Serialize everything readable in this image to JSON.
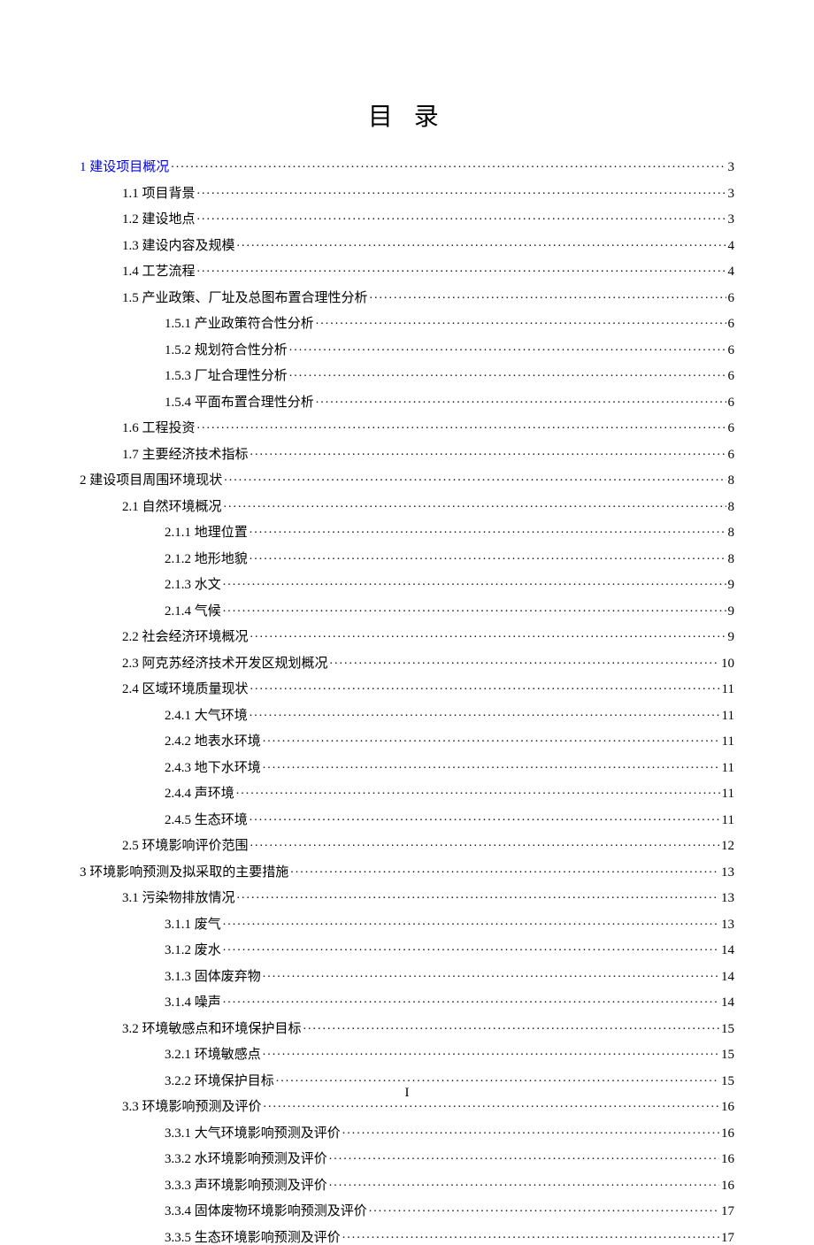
{
  "title": "目 录",
  "page_number": "I",
  "toc": [
    {
      "level": 1,
      "label": "1 建设项目概况",
      "page": "3",
      "link": true
    },
    {
      "level": 2,
      "label": "1.1 项目背景",
      "page": "3",
      "link": false
    },
    {
      "level": 2,
      "label": "1.2 建设地点",
      "page": "3",
      "link": false
    },
    {
      "level": 2,
      "label": "1.3 建设内容及规模",
      "page": "4",
      "link": false
    },
    {
      "level": 2,
      "label": "1.4 工艺流程",
      "page": "4",
      "link": false
    },
    {
      "level": 2,
      "label": "1.5 产业政策、厂址及总图布置合理性分析",
      "page": "6",
      "link": false
    },
    {
      "level": 3,
      "label": "1.5.1 产业政策符合性分析",
      "page": "6",
      "link": false
    },
    {
      "level": 3,
      "label": "1.5.2 规划符合性分析",
      "page": "6",
      "link": false
    },
    {
      "level": 3,
      "label": "1.5.3 厂址合理性分析",
      "page": "6",
      "link": false
    },
    {
      "level": 3,
      "label": "1.5.4 平面布置合理性分析",
      "page": "6",
      "link": false
    },
    {
      "level": 2,
      "label": "1.6 工程投资",
      "page": "6",
      "link": false
    },
    {
      "level": 2,
      "label": "1.7 主要经济技术指标",
      "page": "6",
      "link": false
    },
    {
      "level": 1,
      "label": "2 建设项目周围环境现状",
      "page": "8",
      "link": false
    },
    {
      "level": 2,
      "label": "2.1 自然环境概况",
      "page": "8",
      "link": false
    },
    {
      "level": 3,
      "label": "2.1.1 地理位置",
      "page": "8",
      "link": false
    },
    {
      "level": 3,
      "label": "2.1.2 地形地貌",
      "page": "8",
      "link": false
    },
    {
      "level": 3,
      "label": "2.1.3 水文",
      "page": "9",
      "link": false
    },
    {
      "level": 3,
      "label": "2.1.4 气候",
      "page": "9",
      "link": false
    },
    {
      "level": 2,
      "label": "2.2 社会经济环境概况",
      "page": "9",
      "link": false
    },
    {
      "level": 2,
      "label": "2.3 阿克苏经济技术开发区规划概况",
      "page": "10",
      "link": false
    },
    {
      "level": 2,
      "label": "2.4 区域环境质量现状",
      "page": "11",
      "link": false
    },
    {
      "level": 3,
      "label": "2.4.1 大气环境",
      "page": "11",
      "link": false
    },
    {
      "level": 3,
      "label": "2.4.2 地表水环境",
      "page": "11",
      "link": false
    },
    {
      "level": 3,
      "label": "2.4.3 地下水环境",
      "page": "11",
      "link": false
    },
    {
      "level": 3,
      "label": "2.4.4 声环境",
      "page": "11",
      "link": false
    },
    {
      "level": 3,
      "label": "2.4.5 生态环境",
      "page": "11",
      "link": false
    },
    {
      "level": 2,
      "label": "2.5 环境影响评价范围",
      "page": "12",
      "link": false
    },
    {
      "level": 1,
      "label": "3 环境影响预测及拟采取的主要措施",
      "page": "13",
      "link": false
    },
    {
      "level": 2,
      "label": "3.1 污染物排放情况",
      "page": "13",
      "link": false
    },
    {
      "level": 3,
      "label": "3.1.1 废气",
      "page": "13",
      "link": false
    },
    {
      "level": 3,
      "label": "3.1.2 废水",
      "page": "14",
      "link": false
    },
    {
      "level": 3,
      "label": "3.1.3 固体废弃物",
      "page": "14",
      "link": false
    },
    {
      "level": 3,
      "label": "3.1.4 噪声",
      "page": "14",
      "link": false
    },
    {
      "level": 2,
      "label": "3.2 环境敏感点和环境保护目标",
      "page": "15",
      "link": false
    },
    {
      "level": 3,
      "label": "3.2.1 环境敏感点",
      "page": "15",
      "link": false
    },
    {
      "level": 3,
      "label": "3.2.2 环境保护目标",
      "page": "15",
      "link": false
    },
    {
      "level": 2,
      "label": "3.3 环境影响预测及评价",
      "page": "16",
      "link": false
    },
    {
      "level": 3,
      "label": "3.3.1 大气环境影响预测及评价",
      "page": "16",
      "link": false
    },
    {
      "level": 3,
      "label": "3.3.2 水环境影响预测及评价",
      "page": "16",
      "link": false
    },
    {
      "level": 3,
      "label": "3.3.3 声环境影响预测及评价",
      "page": "16",
      "link": false
    },
    {
      "level": 3,
      "label": "3.3.4 固体废物环境影响预测及评价",
      "page": "17",
      "link": false
    },
    {
      "level": 3,
      "label": "3.3.5 生态环境影响预测及评价",
      "page": "17",
      "link": false
    }
  ]
}
